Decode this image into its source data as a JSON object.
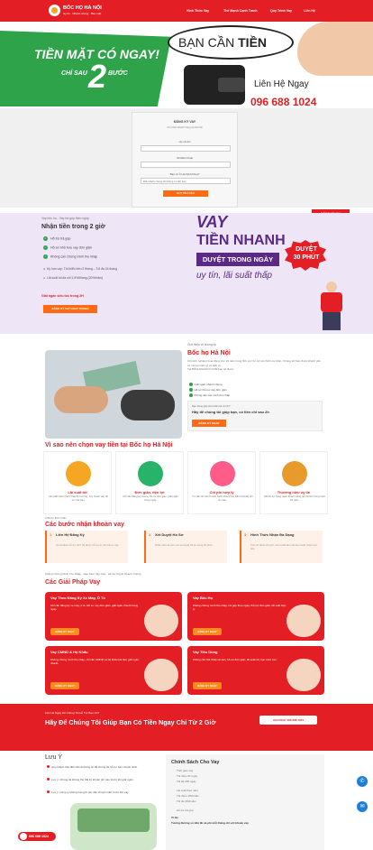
{
  "header": {
    "brand": "BỐC HỌ HÀ NỘI",
    "tagline": "Uy tín · Nhanh chóng · Bảo mật",
    "nav": [
      "Hình Thức Vay",
      "Thế Mạnh Cạnh Tranh",
      "Quy Trình Vay",
      "Liên Hệ"
    ]
  },
  "hero": {
    "line1": "TIỀN MẶT CÓ NGAY!",
    "line2": "CHỈ SAU",
    "big_number": "2",
    "line3": "BƯỚC",
    "bubble_prefix": "BẠN CẦN ",
    "bubble_bold": "TIỀN",
    "contact_label": "Liên Hệ Ngay",
    "phone": "096 688 1024"
  },
  "form": {
    "title": "ĐĂNG KÝ VAY",
    "subtitle": "Chỉ nhận khách hàng tại Hà Nội",
    "name_label": "Họ và tên",
    "phone_label": "Số Điện thoại",
    "type_label": "Bạn có ở Hà Nội không?",
    "type_placeholder": "Điền đánh chúng tôi không tư vấn bạn",
    "submit": "GỬI YÊU CẦU"
  },
  "offer": {
    "small": "Vay bốc họ - Vay trả góp theo ngày",
    "title": "Nhận tiền trong 2 giờ",
    "checks": [
      "Hỗ trợ trả góp",
      "Hỗ sơ nhỏ bưu vay đơn giản",
      "Không cần chứng minh thu nhập"
    ],
    "info": [
      "Kỳ hạn vay: Tối thiểu trên 2 tháng – Tối đa 24 tháng",
      "Lãi suất tối đa chỉ 1,5%/tháng (20%/năm)"
    ],
    "red_note": "Giải ngân siêu tốc trong 2H",
    "cta": "ĐĂNG KÝ VAY NGAY TRONG",
    "vay": "VAY",
    "tien_nhanh": "TIỀN NHANH",
    "duyet_banner": "DUYỆT TRONG NGÀY",
    "uy_tin": "uy tín, lãi suất thấp",
    "badge_line1": "DUYỆT",
    "badge_line2": "30 PHÚT",
    "register_tab": "ĐĂNG KÝ VAY"
  },
  "about": {
    "small": "Giới thiệu về chúng tôi",
    "title": "Bốc họ Hà Nội",
    "para": "Với kinh nghiệm hoạt động trên 10 năm trong lĩnh vực hỗ trợ tài chính cá nhân, Chúng tôi hiểu được khách cần có mong muốn gì từ dịch vụ.",
    "sub": "Tại BỐCHOHANOI.COM bạn sẽ được:",
    "list": [
      "Giải ngân nhanh chóng",
      "Hồ sơ thủ tục vay đơn giản",
      "Không cần xác minh thu nhập"
    ],
    "box_small": "Bạn đang gặp khó khăn tài chính?",
    "box_title": "Hãy để chúng tôi giúp bạn, có tiền chỉ sau 2h",
    "box_btn": "ĐĂNG KÝ NGAY"
  },
  "why": {
    "title": "Vì sao nên chọn vay tiền tại Bốc họ Hà Nội",
    "cards": [
      {
        "title": "Lãi suất tốt",
        "desc": "Lãi suất cạnh tranh thấp thị trường. Tùy thuộc vào hồ sơ của bạn."
      },
      {
        "title": "Đơn giản, tiện lợi",
        "desc": "Chỉ cần đăng ký online, tối ưu thời gian, giải ngân trong ngày."
      },
      {
        "title": "Chi phí hợp lý",
        "desc": "Tư vấn tài chính minh bạch không thu bất kì khoản phí ẩn nào."
      },
      {
        "title": "Thương hiệu uy tín",
        "desc": "Đã hỗ trợ hàng ngàn khách hàng tại Hà Nội trong suốt 10 năm."
      }
    ],
    "colors": [
      "#f5a623",
      "#27b36a",
      "#ff5c8a",
      "#e89a2c"
    ]
  },
  "steps": {
    "small": "3 Bước Đơn Giản",
    "title": "Các bước nhận khoản vay",
    "items": [
      {
        "num": "1",
        "title": "Liên Hệ Đăng Ký",
        "desc": "Gọi Hotline hỗ trợ 24/7 để được hỗ trợ tư vấn hồ sơ vay."
      },
      {
        "num": "2",
        "title": "Xét Duyệt Hồ Sơ",
        "desc": "Nhân viên sẽ xem xét và duyệt hồ sơ trong 30 phút."
      },
      {
        "num": "3",
        "title": "Hình Thức Nhận Đa Dạng",
        "desc": "Tiền sẽ được chuyển vào tài khoản của bạn hoặc nhận trực tiếp."
      }
    ]
  },
  "solutions": {
    "small": "Không Chứng Minh Thu Nhập · Hạn Mức Vay Cao · Hồ Sơ Duyệt Nhanh Chóng",
    "title": "Các Giải Pháp Vay",
    "cards": [
      {
        "title": "Vay Theo Đăng Ký Xe Máy, Ô Tô",
        "desc": "Chỉ cần đăng ký xe máy, ô tô. Hồ sơ vay đơn giản, giải ngân nhanh trong ngày.",
        "btn": "ĐĂNG KÝ NGAY"
      },
      {
        "title": "Vay Bốc Họ",
        "desc": "Không chứng minh thu nhập, trả góp theo ngày, thủ tục đơn giản, lãi suất hợp lý.",
        "btn": "ĐĂNG KÝ NGAY"
      },
      {
        "title": "Vay CMND & Hộ Khẩu",
        "desc": "Không chứng minh thu nhập, chỉ cần CMND và hộ khẩu Hà Nội, giải ngân nhanh.",
        "btn": "ĐĂNG KÝ NGAY"
      },
      {
        "title": "Vay Tiêu Dùng",
        "desc": "Không cần thế chấp tài sản, hồ sơ đơn giản, lãi suất tốt, hạn mức cao.",
        "btn": "ĐĂNG KÝ NGAY"
      }
    ]
  },
  "cta": {
    "small": "Liên Hệ Ngay Để Chúng Tôi Hỗ Trợ Bạn 24/7",
    "title": "Hãy Để Chúng Tôi Giúp Bạn Có Tiền Ngay Chỉ Từ 2 Giờ",
    "btn": "GỌI NGAY 096 688 1024"
  },
  "notes": {
    "title": "Lưu Ý",
    "items": [
      "Quý khách hãy điền tất cả thông tin để chúng tôi hỗ trợ bạn nhanh nhất.",
      "Lưu ý: Chúng tôi không thu bất kỳ khoản phí nào trước khi giải ngân.",
      "Lưu ý: Công ty không bao giờ yêu cầu chuyển tiền trước khi vay."
    ]
  },
  "policy": {
    "title": "Chính Sách Cho Vay",
    "items": [
      "Thời gian vay",
      "Tối thiểu 61 ngày",
      "Tối đa 365 ngày",
      "Lãi suất theo năm",
      "Tối thiểu 15%/năm",
      "Tối đa 36%/năm",
      "Hỗ trợ trả góp"
    ],
    "example_title": "Ví dụ:",
    "example": "Tương đương số tiền lãi và phí mỗi tháng chỉ với khoản vay"
  },
  "fixed_phone": "096 688 1024"
}
